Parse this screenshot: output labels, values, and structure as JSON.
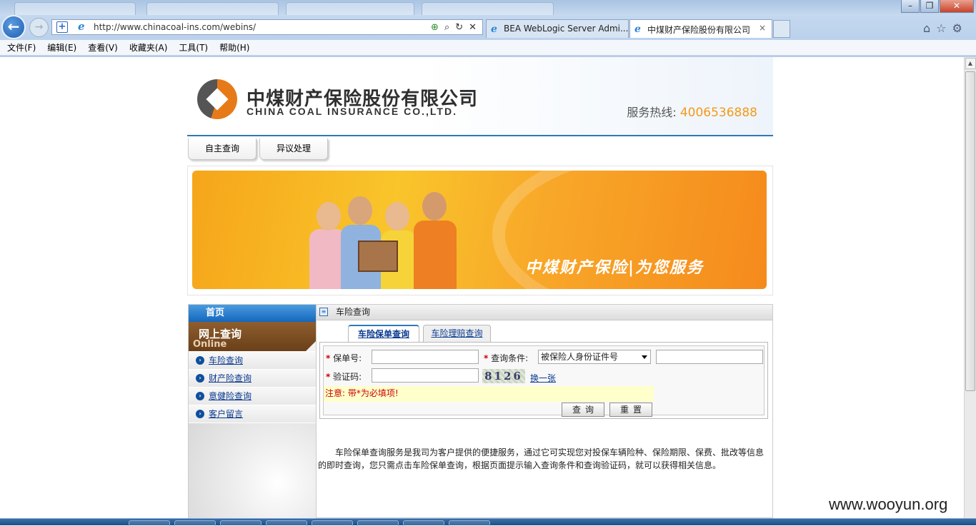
{
  "browser": {
    "address_url": "http://www.chinacoal-ins.com/webins/",
    "tabs": [
      {
        "label": "BEA WebLogic Server Admi..."
      },
      {
        "label": "中煤财产保险股份有限公司",
        "close": "×"
      }
    ],
    "background_tab_titles": [
      "...",
      "...",
      "...",
      "..."
    ],
    "window_buttons": {
      "minimize": "–",
      "restore": "❐",
      "close": "✕"
    }
  },
  "menu": [
    "文件(F)",
    "编辑(E)",
    "查看(V)",
    "收藏夹(A)",
    "工具(T)",
    "帮助(H)"
  ],
  "header": {
    "company_cn": "中煤财产保险股份有限公司",
    "company_en": "CHINA  COAL  INSURANCE CO.,LTD.",
    "hotline_label": "服务热线: ",
    "hotline_number": "4006536888"
  },
  "nav": [
    "自主查询",
    "异议处理"
  ],
  "banner": {
    "slogan": "中煤财产保险|为您服务"
  },
  "sidebar": {
    "home": "首页",
    "online_cn": "网上查询",
    "online_en": "Online",
    "items": [
      "车险查询",
      "财产险查询",
      "意健险查询",
      "客户留言"
    ]
  },
  "main": {
    "title": "车险查询",
    "tabs": [
      "车险保单查询",
      "车险理赔查询"
    ],
    "form": {
      "policy_label": "保单号:",
      "condition_label": "查询条件:",
      "condition_selected": "被保险人身份证件号",
      "captcha_label": "验证码:",
      "captcha_text": "8126",
      "change_link": "换一张",
      "notice": "注意: 带*为必填项!",
      "query_button": "查询",
      "reset_button": "重置",
      "required_mark": "*"
    },
    "description": "车险保单查询服务是我司为客户提供的便捷服务，通过它可实现您对投保车辆险种、保险期限、保费、批改等信息的即时查询，您只需点击车险保单查询，根据页面提示输入查询条件和查询验证码，就可以获得相关信息。"
  },
  "watermark": "www.wooyun.org",
  "colors": {
    "brand_orange": "#f39a1a",
    "accent_blue": "#2d7ab8",
    "required_red": "#cc0000"
  }
}
